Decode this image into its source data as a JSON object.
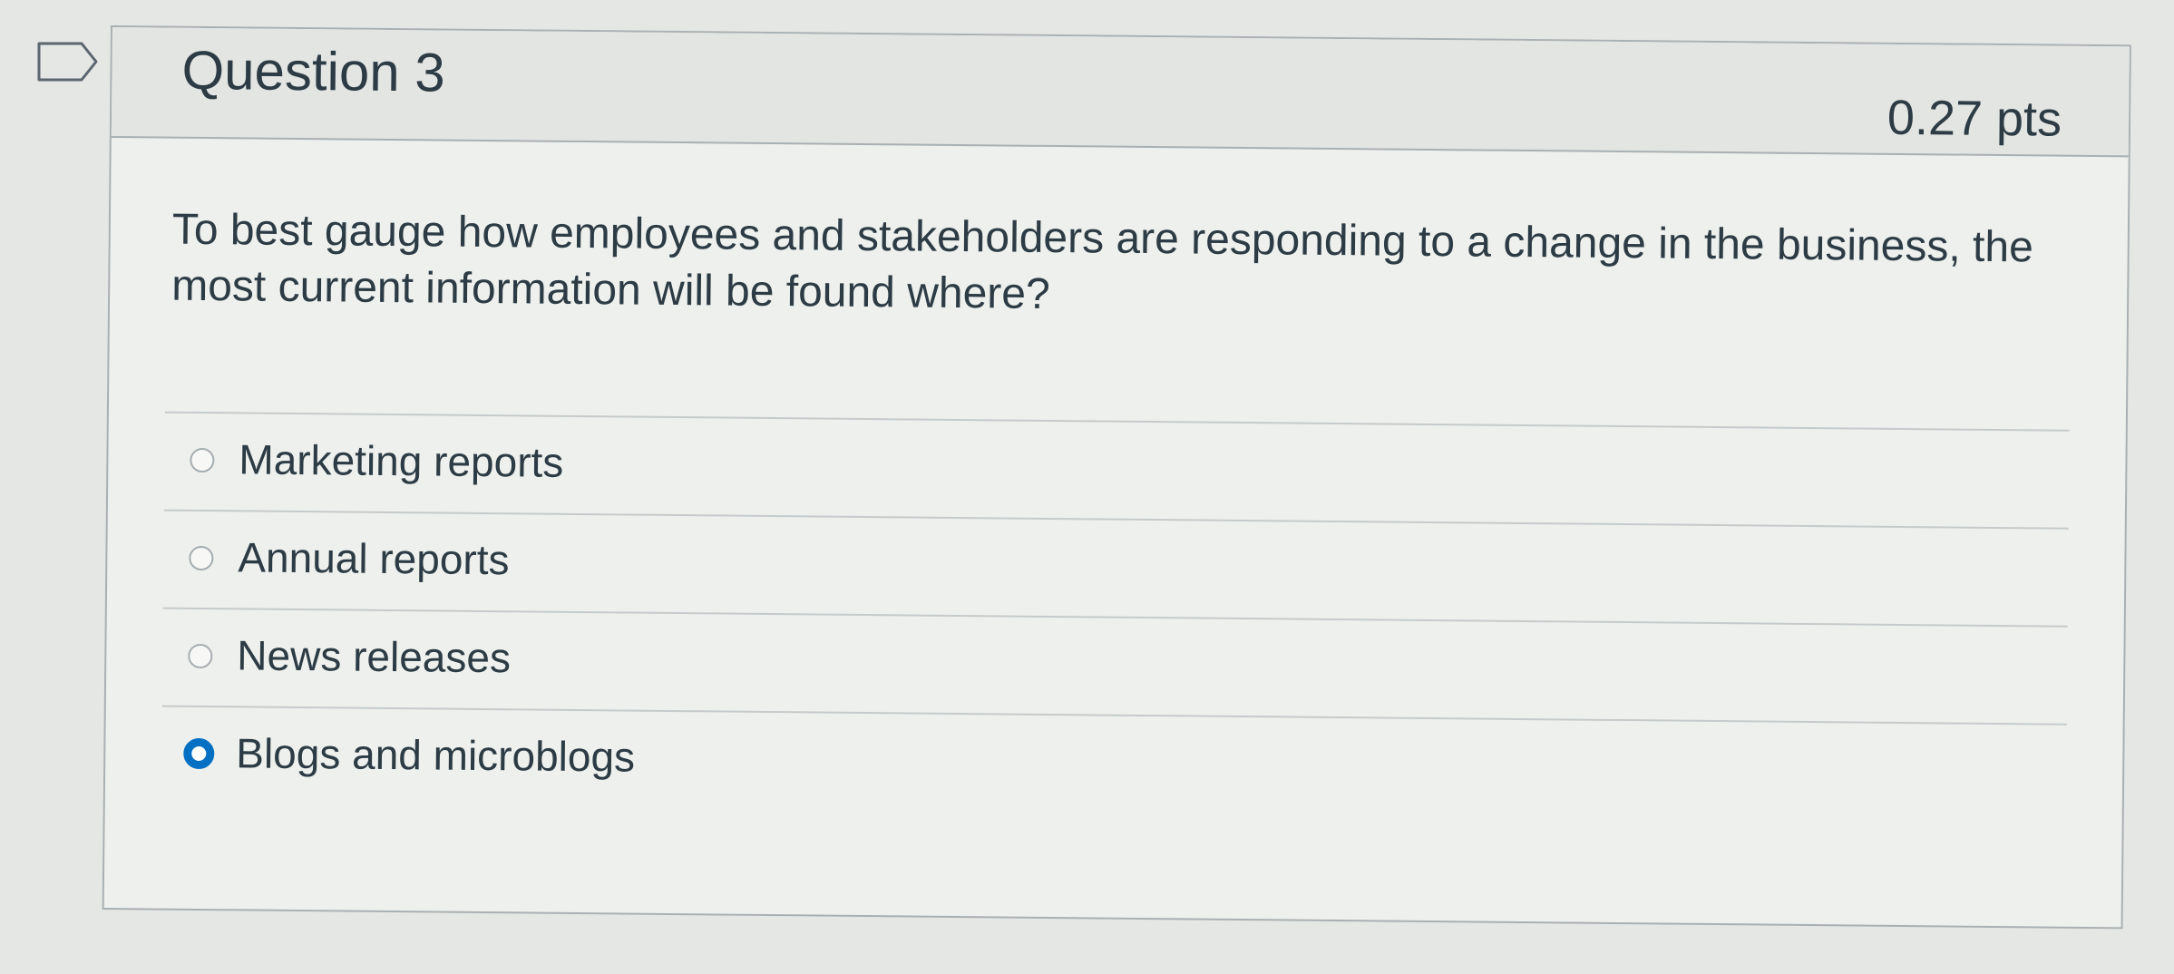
{
  "question": {
    "title": "Question 3",
    "points": "0.27 pts",
    "text": "To best gauge how employees and stakeholders are responding to a change in the business, the most current information will be found where?",
    "answers": [
      {
        "label": "Marketing reports",
        "selected": false
      },
      {
        "label": "Annual reports",
        "selected": false
      },
      {
        "label": "News releases",
        "selected": false
      },
      {
        "label": "Blogs and microblogs",
        "selected": true
      }
    ]
  },
  "colors": {
    "accent_radio": "#0370c4",
    "text": "#2d3b45",
    "border": "#a9b0b3"
  },
  "icons": {
    "flag": "flag-question-icon"
  }
}
